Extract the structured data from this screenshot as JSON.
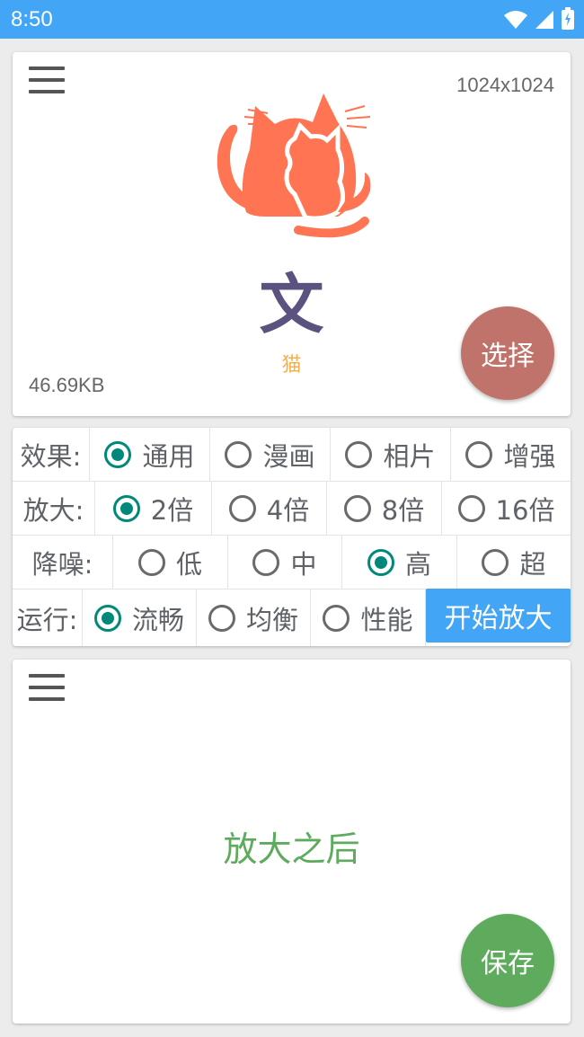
{
  "status_bar": {
    "time": "8:50"
  },
  "input_panel": {
    "resolution": "1024x1024",
    "file_size": "46.69KB",
    "wen_glyph": "文",
    "image_label": "猫",
    "select_button": "选择"
  },
  "options": {
    "effect": {
      "label": "效果:",
      "choices": [
        {
          "label": "通用",
          "selected": true
        },
        {
          "label": "漫画",
          "selected": false
        },
        {
          "label": "相片",
          "selected": false
        },
        {
          "label": "增强",
          "selected": false
        }
      ]
    },
    "scale": {
      "label": "放大:",
      "choices": [
        {
          "label": "2倍",
          "selected": true
        },
        {
          "label": "4倍",
          "selected": false
        },
        {
          "label": "8倍",
          "selected": false
        },
        {
          "label": "16倍",
          "selected": false
        }
      ]
    },
    "denoise": {
      "label": "降噪:",
      "choices": [
        {
          "label": "低",
          "selected": false
        },
        {
          "label": "中",
          "selected": false
        },
        {
          "label": "高",
          "selected": true
        },
        {
          "label": "超",
          "selected": false
        }
      ]
    },
    "run": {
      "label": "运行:",
      "choices": [
        {
          "label": "流畅",
          "selected": true
        },
        {
          "label": "均衡",
          "selected": false
        },
        {
          "label": "性能",
          "selected": false
        }
      ],
      "start_button": "开始放大"
    }
  },
  "output_panel": {
    "placeholder": "放大之后",
    "save_button": "保存"
  },
  "colors": {
    "accent_blue": "#42a5f5",
    "radio_selected": "#00897b",
    "select_fab": "#c0736a",
    "save_fab": "#5eab5e",
    "cat_logo": "#ff7452"
  },
  "icons": [
    "wifi-icon",
    "signal-icon",
    "battery-icon",
    "menu-icon",
    "cat-logo-icon"
  ]
}
